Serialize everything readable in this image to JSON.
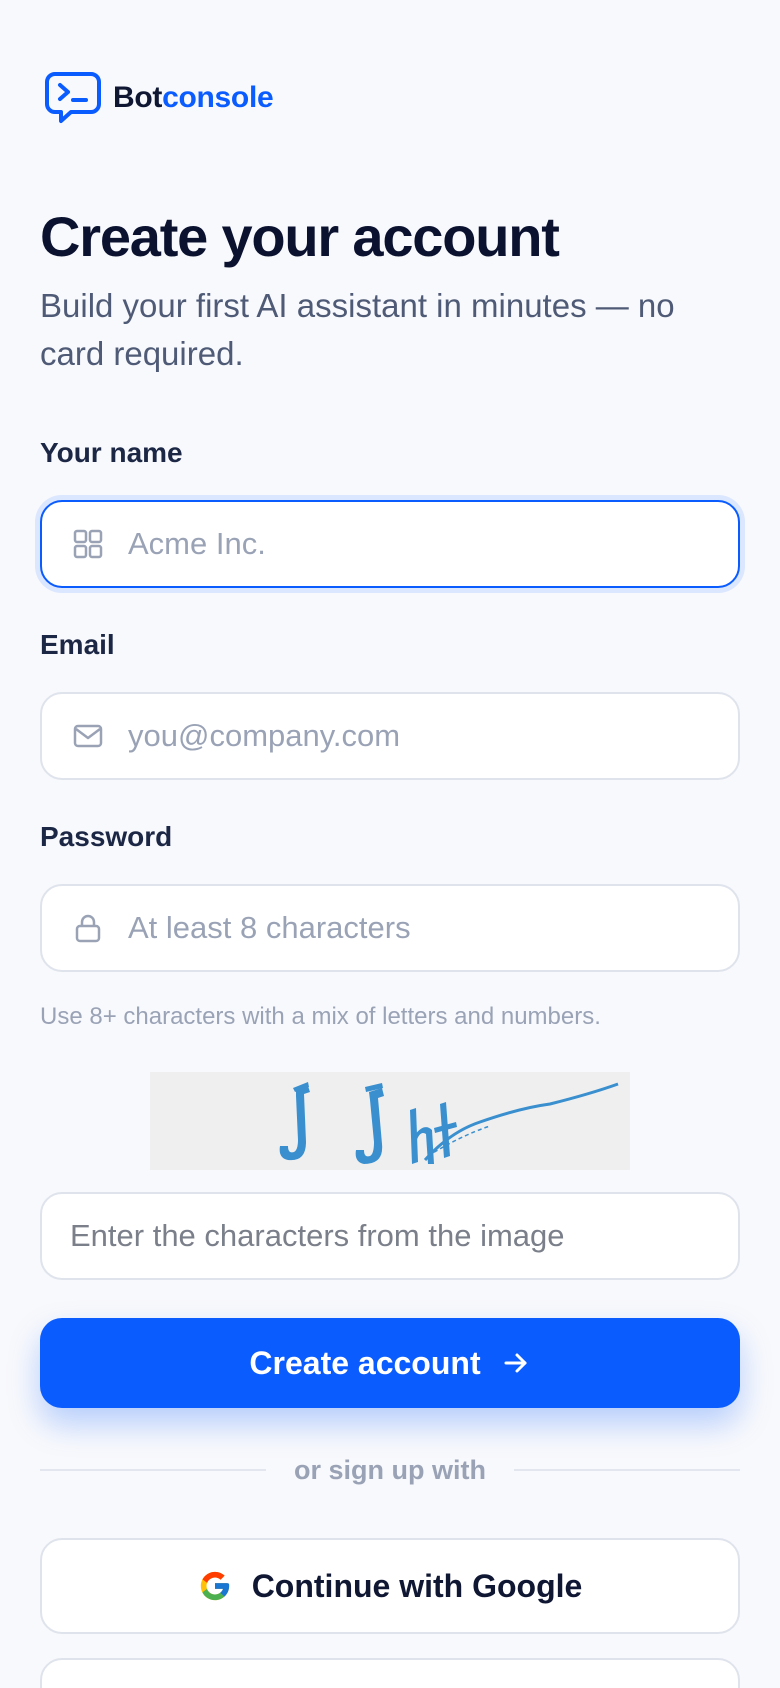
{
  "brand": {
    "name_part1": "Bot",
    "name_part2": "console",
    "accent_color": "#0a5cff",
    "logo_icon": "chat-terminal-icon"
  },
  "header": {
    "title": "Create your account",
    "subtitle": "Build your first AI assistant in minutes — no card required."
  },
  "form": {
    "name": {
      "label": "Your name",
      "placeholder": "Acme Inc.",
      "value": "",
      "icon": "grid-icon",
      "focused": true
    },
    "email": {
      "label": "Email",
      "placeholder": "you@company.com",
      "value": "",
      "icon": "mail-icon"
    },
    "password": {
      "label": "Password",
      "placeholder": "At least 8 characters",
      "value": "",
      "icon": "lock-icon",
      "hint": "Use 8+ characters with a mix of letters and numbers."
    },
    "captcha": {
      "image_text": "JJht",
      "placeholder": "Enter the characters from the image",
      "value": ""
    },
    "submit_label": "Create account"
  },
  "divider_text": "or sign up with",
  "social": {
    "google_label": "Continue with Google"
  }
}
